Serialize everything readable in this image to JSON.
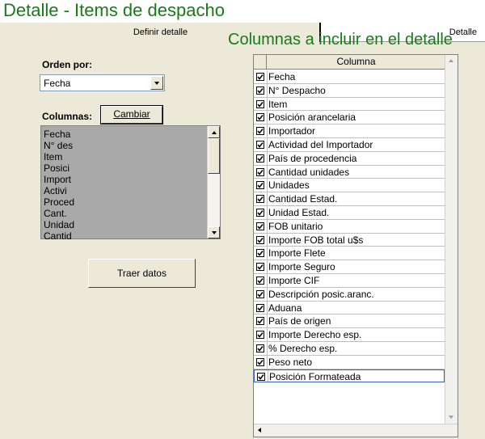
{
  "window": {
    "title": "Detalle - Items de despacho"
  },
  "tabs": [
    {
      "label": "Definir detalle",
      "active": true
    },
    {
      "label": "Detalle",
      "active": false
    }
  ],
  "left": {
    "orden_label": "Orden por:",
    "orden_value": "Fecha",
    "columnas_label": "Columnas:",
    "cambiar_button_label": "Cambiar",
    "columnas_list": [
      "Fecha",
      "N° des",
      "Item",
      "Posici",
      "Import",
      "Activi",
      "Proced",
      "Cant.",
      "Unidad",
      "Cantid"
    ],
    "traer_button_label": "Traer datos"
  },
  "right": {
    "title": "Columnas a incluir en el detalle",
    "grid_header": "Columna",
    "rows": [
      {
        "label": "Fecha",
        "checked": true
      },
      {
        "label": "N° Despacho",
        "checked": true
      },
      {
        "label": "Item",
        "checked": true
      },
      {
        "label": "Posición arancelaria",
        "checked": true
      },
      {
        "label": "Importador",
        "checked": true
      },
      {
        "label": "Actividad del Importador",
        "checked": true
      },
      {
        "label": "País de procedencia",
        "checked": true
      },
      {
        "label": "Cantidad unidades",
        "checked": true
      },
      {
        "label": "Unidades",
        "checked": true
      },
      {
        "label": "Cantidad Estad.",
        "checked": true
      },
      {
        "label": "Unidad Estad.",
        "checked": true
      },
      {
        "label": "FOB unitario",
        "checked": true
      },
      {
        "label": "Importe FOB total u$s",
        "checked": true
      },
      {
        "label": "Importe Flete",
        "checked": true
      },
      {
        "label": "Importe Seguro",
        "checked": true
      },
      {
        "label": "Importe CIF",
        "checked": true
      },
      {
        "label": "Descripción posic.aranc.",
        "checked": true
      },
      {
        "label": "Aduana",
        "checked": true
      },
      {
        "label": "País de origen",
        "checked": true
      },
      {
        "label": "Importe Derecho esp.",
        "checked": true
      },
      {
        "label": "% Derecho esp.",
        "checked": true
      },
      {
        "label": "Peso neto",
        "checked": true
      },
      {
        "label": "Posición Formateada",
        "checked": true,
        "active": true
      }
    ]
  },
  "colors": {
    "title_green": "#1a7a1a",
    "panel_bg": "#ece9d8",
    "list_bg": "#a9a9a9"
  }
}
